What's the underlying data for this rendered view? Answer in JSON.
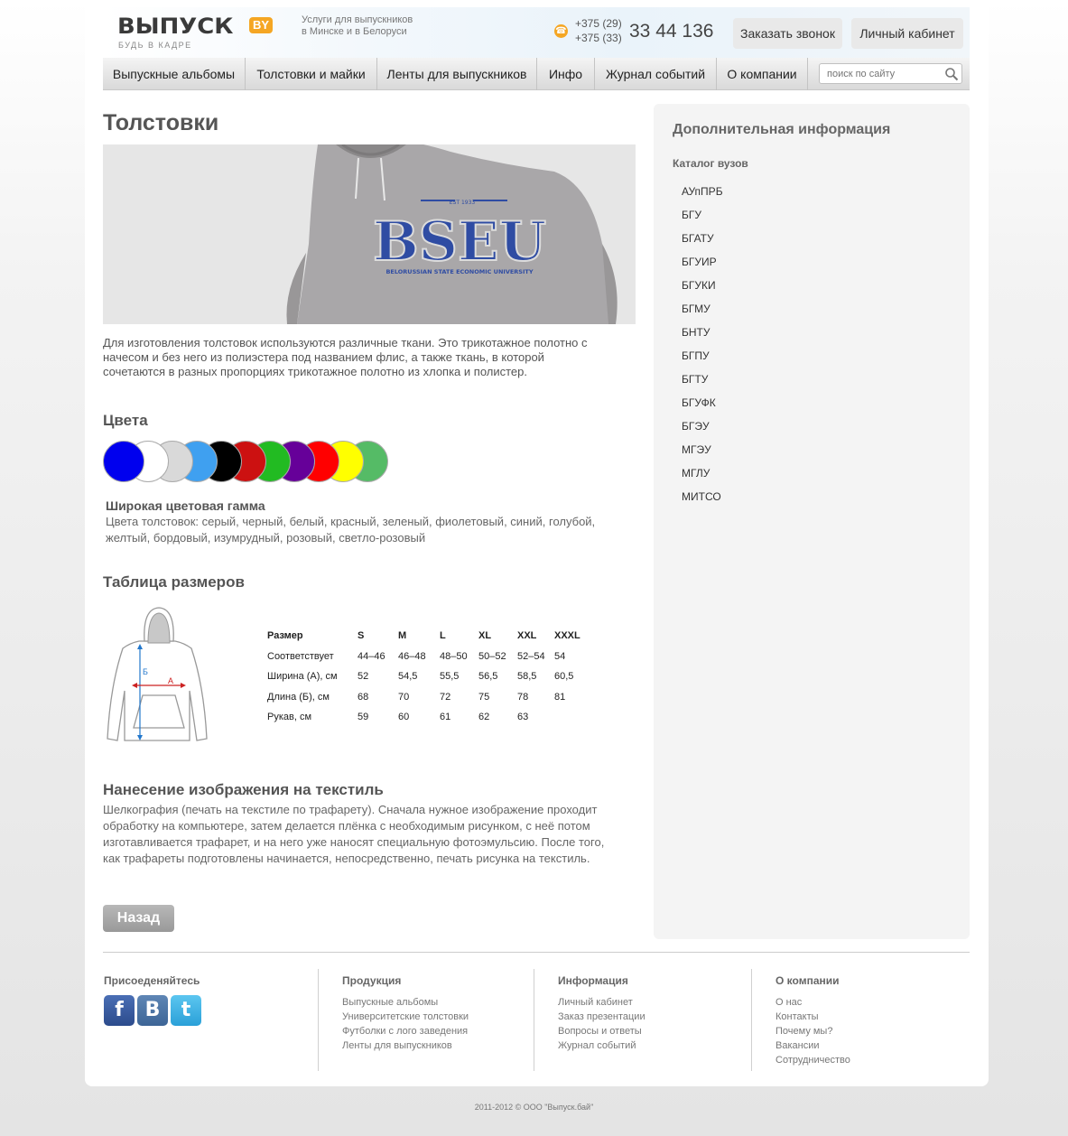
{
  "header": {
    "logo_text": "ВЫПУСК",
    "logo_badge": "BY",
    "logo_tagline": "БУДЬ В КАДРЕ",
    "services_line1": "Услуги для выпускников",
    "services_line2": "в Минске и в Белоруси",
    "phone_code_1": "+375 (29)",
    "phone_code_2": "+375 (33)",
    "phone_number": "33 44 136",
    "call_button": "Заказать звонок",
    "cabinet_button": "Личный кабинет"
  },
  "nav": {
    "items": [
      "Выпускные альбомы",
      "Толстовки и майки",
      "Ленты для выпускников",
      "Инфо",
      "Журнал событий",
      "О компании"
    ],
    "search_placeholder": "поиск по сайту"
  },
  "main": {
    "title": "Толстовки",
    "hero_text": "BSEU",
    "hero_est": "EST 1933",
    "hero_subtitle": "BELORUSSIAN STATE ECONOMIC UNIVERSITY",
    "intro": "Для изготовления толстовок используются различные ткани. Это трикотажное полотно с начесом и без него из полиэстера под названием флис, а также ткань, в которой сочетаются в разных пропорциях трикотажное полотно из хлопка и полистер.",
    "colors_heading": "Цвета",
    "swatches": [
      "#0000ee",
      "#ffffff",
      "#d9d9d9",
      "#3fa0f0",
      "#000000",
      "#cc1111",
      "#22bb22",
      "#660099",
      "#ff0000",
      "#ffff00",
      "#55bb66"
    ],
    "gamma_title": "Широкая цветовая гамма",
    "gamma_text": "Цвета толстовок: серый, черный, белый, красный, зеленый, фиолетовый, синий, голубой, желтый, бордовый, изумрудный, розовый, светло-розовый",
    "sizes_heading": "Таблица размеров",
    "fig_label_a": "А",
    "fig_label_b": "Б",
    "size_table": {
      "header": [
        "Размер",
        "S",
        "M",
        "L",
        "XL",
        "XXL",
        "XXXL"
      ],
      "rows": [
        [
          "Соответствует",
          "44–46",
          "46–48",
          "48–50",
          "50–52",
          "52–54",
          "54"
        ],
        [
          "Ширина (А), см",
          "52",
          "54,5",
          "55,5",
          "56,5",
          "58,5",
          "60,5"
        ],
        [
          "Длина (Б), см",
          "68",
          "70",
          "72",
          "75",
          "78",
          "81"
        ],
        [
          "Рукав, см",
          "59",
          "60",
          "61",
          "62",
          "63",
          ""
        ]
      ]
    },
    "print_heading": "Нанесение изображения на текстиль",
    "print_text": "Шелкография (печать на текстиле по трафарету). Сначала нужное изображение проходит обработку на компьютере, затем делается плёнка с необходимым рисунком, с неё потом изготавливается трафарет, и на него уже наносят специальную фотоэмульсию. После того, как трафареты подготовлены начинается, непосредственно, печать рисунка на текстиль.",
    "back_button": "Назад"
  },
  "sidebar": {
    "title": "Дополнительная информация",
    "subtitle": "Каталог вузов",
    "items": [
      "АУпПРБ",
      "БГУ",
      "БГАТУ",
      "БГУИР",
      "БГУКИ",
      "БГМУ",
      "БНТУ",
      "БГПУ",
      "БГТУ",
      "БГУФК",
      "БГЭУ",
      "МГЭУ",
      "МГЛУ",
      "МИТСО"
    ]
  },
  "footer": {
    "join_title": "Присоеденяйтесь",
    "social": [
      "facebook-icon",
      "vkontakte-icon",
      "twitter-icon"
    ],
    "social_glyphs": [
      "f",
      "В",
      "t"
    ],
    "products_title": "Продукция",
    "products": [
      "Выпускные альбомы",
      "Университетские толстовки",
      "Футболки с лого заведения",
      "Ленты для выпускников"
    ],
    "info_title": "Информация",
    "info": [
      "Личный кабинет",
      "Заказ презентации",
      "Вопросы и ответы",
      "Журнал событий"
    ],
    "company_title": "О компании",
    "company": [
      "О нас",
      "Контакты",
      "Почему мы?",
      "Вакансии",
      "Сотрудничество"
    ],
    "copyright": "2011-2012 © ООО \"Выпуск.бай\""
  },
  "colors": {
    "accent_orange": "#f5a623",
    "hoodie_print_blue": "#2f4ca3",
    "measure_red": "#cc2222",
    "measure_blue": "#2277cc"
  }
}
